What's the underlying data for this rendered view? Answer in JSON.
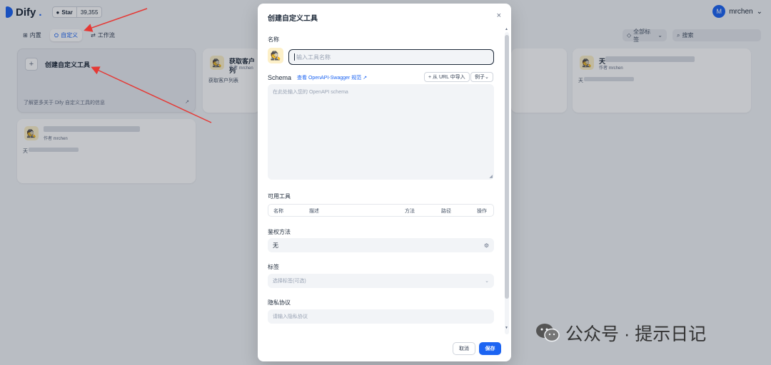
{
  "app": {
    "logo_text": "Dify",
    "github_star_label": "Star",
    "github_star_count": "39,355",
    "user_initial": "M",
    "user_name": "mrchen"
  },
  "tabs": [
    {
      "label": "内置",
      "icon": "grid-icon"
    },
    {
      "label": "自定义",
      "icon": "custom-icon",
      "active": true
    },
    {
      "label": "工作流",
      "icon": "workflow-icon"
    }
  ],
  "filters": {
    "tags_label": "全部标签",
    "search_placeholder": "搜索"
  },
  "create_card": {
    "plus": "+",
    "title": "创建自定义工具",
    "learn_more": "了解更多关于 Dify 自定义工具的信息",
    "link_arrow": "↗"
  },
  "tool_cards": [
    {
      "name": "获取客户列",
      "author": "作者 mrchen",
      "desc": "获取客户列表"
    },
    {
      "name": "天",
      "author": "作者 mrchen",
      "desc": "天"
    },
    {
      "name": "",
      "author": "作者 mrchen",
      "desc": "天"
    }
  ],
  "modal": {
    "title": "创建自定义工具",
    "close": "×",
    "name_label": "名称",
    "name_placeholder": "输入工具名称",
    "schema_label": "Schema",
    "swagger_link": "查看 OpenAPI-Swagger 规范",
    "import_url": "+ 从 URL 中导入",
    "examples": "例子",
    "schema_placeholder": "在此处输入您的 OpenAPI schema",
    "tools_label": "可用工具",
    "tools_columns": [
      "名称",
      "描述",
      "方法",
      "路径",
      "操作"
    ],
    "auth_label": "鉴权方法",
    "auth_value": "无",
    "tags_label": "标签",
    "tags_placeholder": "选择标签(可选)",
    "privacy_label": "隐私协议",
    "privacy_placeholder": "请输入隐私协议",
    "cancel": "取消",
    "save": "保存"
  },
  "watermark": {
    "text": "公众号 · 提示日记"
  },
  "colors": {
    "accent": "#1c64f2",
    "arrow": "#e53935"
  }
}
